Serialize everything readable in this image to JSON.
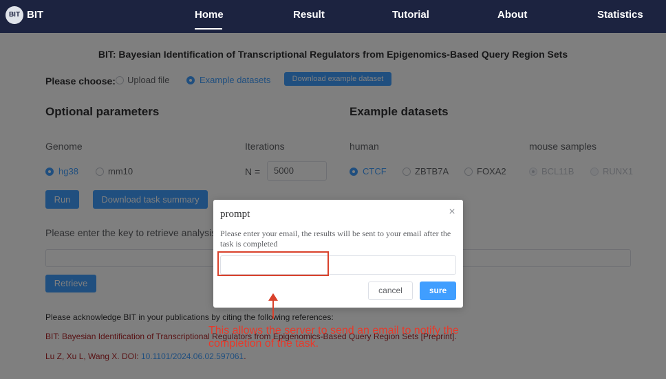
{
  "nav": {
    "logo_text": "BIT",
    "brand": "BIT",
    "items": [
      "Home",
      "Result",
      "Tutorial",
      "About",
      "Statistics"
    ],
    "active": "Home"
  },
  "page": {
    "title": "BIT: Bayesian Identification of Transcriptional Regulators from Epigenomics-Based Query Region Sets",
    "choose_label": "Please choose:",
    "choose_options": [
      "Upload file",
      "Example datasets"
    ],
    "choose_selected": "Example datasets",
    "download_example_label": "Download example dataset",
    "optional_title": "Optional parameters",
    "genome_label": "Genome",
    "genome_options": [
      "hg38",
      "mm10"
    ],
    "genome_selected": "hg38",
    "iterations_label": "Iterations",
    "n_prefix": "N =",
    "n_value": "5000",
    "run_label": "Run",
    "download_summary_label": "Download task summary",
    "example_title": "Example datasets",
    "human_label": "human",
    "human_options": [
      "CTCF",
      "ZBTB7A",
      "FOXA2"
    ],
    "human_selected": "CTCF",
    "mouse_label": "mouse samples",
    "mouse_options": [
      "BCL11B",
      "RUNX1"
    ],
    "retrieve_prompt": "Please enter the key to retrieve analysis",
    "retrieve_label": "Retrieve",
    "ack_text": "Please acknowledge BIT in your publications by citing the following references:",
    "ref_title": "BIT: Bayesian Identification of Transcriptional Regulators from Epigenomics-Based Query Region Sets [Preprint].",
    "ref_authors": "Lu Z, Xu L, Wang X. DOI: ",
    "ref_doi": "10.1101/2024.06.02.597061",
    "ref_end": "."
  },
  "dialog": {
    "title": "prompt",
    "close_glyph": "×",
    "message": "Please enter your email, the results will be sent to your email after the task is completed",
    "email_value": "",
    "cancel_label": "cancel",
    "sure_label": "sure"
  },
  "annotation": {
    "text": "This allows the server to send an email to notify the completion of the task.",
    "color": "#e8392a"
  },
  "colors": {
    "navbar": "#1c2340",
    "primary": "#409eff",
    "reference_red": "#b0262a"
  }
}
